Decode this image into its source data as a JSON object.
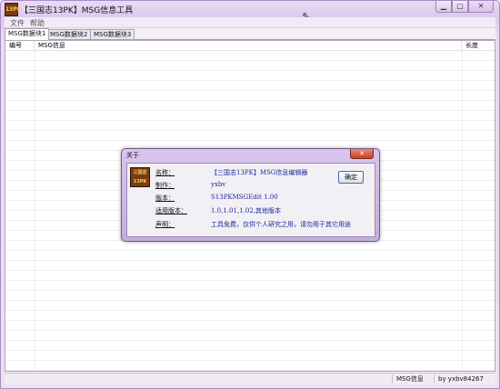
{
  "window": {
    "title": "【三国志13PK】MSG信息工具",
    "icon_text": "13PK"
  },
  "window_controls": {
    "minimize": "▁",
    "maximize": "▢",
    "close": "✕"
  },
  "menu": {
    "items": [
      "文件",
      "帮助"
    ]
  },
  "tabs": [
    "MSG数据块1",
    "MSG数据块2",
    "MSG数据块3"
  ],
  "list": {
    "columns": [
      "编号",
      "MSG信息",
      "长度"
    ]
  },
  "status": {
    "panes": [
      "MSG信息",
      "by yxbv84267"
    ]
  },
  "about_dialog": {
    "title": "关于",
    "close": "✕",
    "logo_text": "三国志13PK",
    "ok_label": "确定",
    "rows": [
      {
        "label": "名称：",
        "value": "【三国志13PK】MSG信息编辑器"
      },
      {
        "label": "制作：",
        "value": "yxbv"
      },
      {
        "label": "版本：",
        "value": "S13PKMSGEdit 1.00"
      },
      {
        "label": "适用版本：",
        "value": "1.0,1.01,1.02,其他版本"
      },
      {
        "label": "声明：",
        "value": "工具免费，仅供个人研究之用，请勿用于其它用途"
      }
    ]
  },
  "colors": {
    "accent": "#1a2a9a",
    "titlebar": "#dcc8ef"
  }
}
